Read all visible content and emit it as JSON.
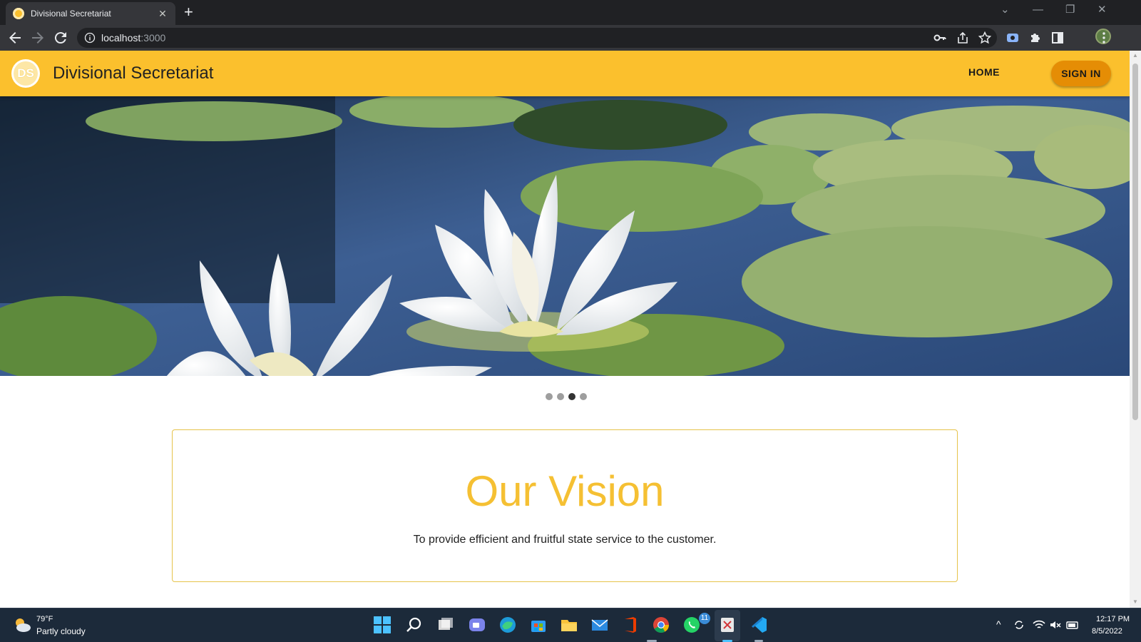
{
  "browser": {
    "tab_title": "Divisional Secretariat",
    "tab_close": "✕",
    "new_tab": "+",
    "url_host": "localhost",
    "url_port": ":3000",
    "window_controls": {
      "tabs_dropdown": "⌄",
      "minimize": "—",
      "restore": "❐",
      "close": "✕"
    }
  },
  "site": {
    "logo_text": "DS",
    "title": "Divisional Secretariat",
    "nav": {
      "home": "HOME",
      "sign_in": "SIGN IN"
    },
    "brand_color": "#fbc02d",
    "accent_color": "#e58d05"
  },
  "carousel": {
    "slide_count": 4,
    "active_index": 3,
    "image": "white-water-lilies-on-pond"
  },
  "vision": {
    "title": "Our Vision",
    "text": "To provide efficient and fruitful state service to the customer."
  },
  "taskbar": {
    "weather": {
      "temp": "79°F",
      "condition": "Partly cloudy"
    },
    "whatsapp_badge": "11",
    "clock": {
      "time": "12:17 PM",
      "date": "8/5/2022"
    },
    "tray_chevron": "^"
  }
}
